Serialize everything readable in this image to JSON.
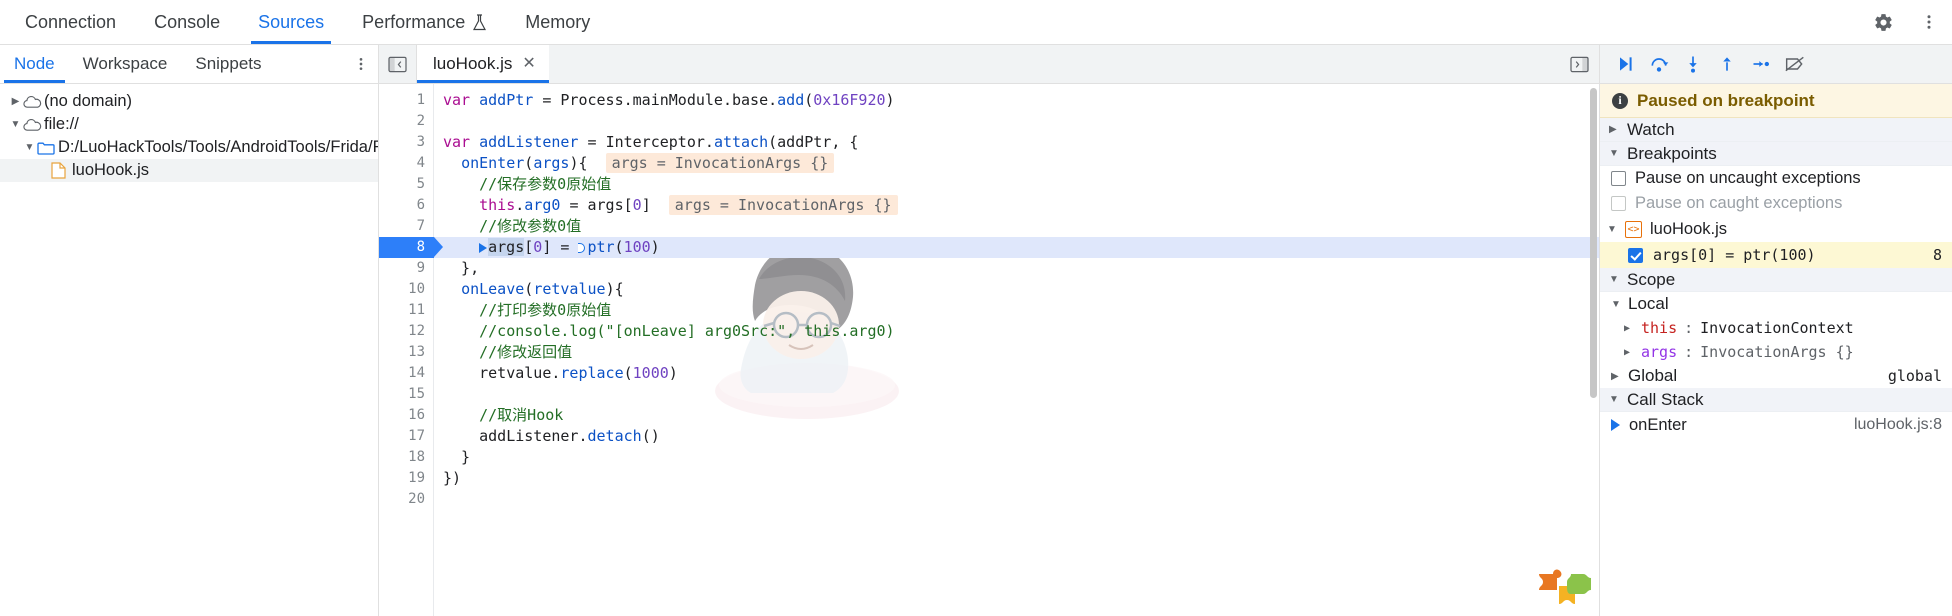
{
  "main_tabs": [
    {
      "label": "Connection",
      "selected": false,
      "icon": null
    },
    {
      "label": "Console",
      "selected": false,
      "icon": null
    },
    {
      "label": "Sources",
      "selected": true,
      "icon": null
    },
    {
      "label": "Performance",
      "selected": false,
      "icon": "flask-icon"
    },
    {
      "label": "Memory",
      "selected": false,
      "icon": null
    }
  ],
  "main_tabs_right": [
    {
      "name": "settings-gear-icon",
      "glyph": "⚙"
    },
    {
      "name": "more-vertical-icon",
      "glyph": "⋮"
    }
  ],
  "navigator": {
    "tabs": [
      {
        "label": "Node",
        "selected": true
      },
      {
        "label": "Workspace",
        "selected": false
      },
      {
        "label": "Snippets",
        "selected": false
      }
    ],
    "more_label": "⋮",
    "tree": [
      {
        "label": "(no domain)",
        "depth": 0,
        "icon": "cloud-icon",
        "expanded": false,
        "selected": false
      },
      {
        "label": "file://",
        "depth": 0,
        "icon": "cloud-icon",
        "expanded": true,
        "selected": false
      },
      {
        "label": "D:/LuoHackTools/Tools/AndroidTools/Frida/Frida-Age",
        "depth": 1,
        "icon": "folder-icon",
        "expanded": true,
        "selected": false
      },
      {
        "label": "luoHook.js",
        "depth": 2,
        "icon": "js-file-icon",
        "expanded": null,
        "selected": true
      }
    ]
  },
  "editor": {
    "panel_toggle_icon": "show-navigator-icon",
    "right_toggle_icon": "show-debugger-icon",
    "tab": {
      "label": "luoHook.js",
      "close_label": "✕"
    },
    "current_line": 8,
    "total_lines": 20,
    "lines": [
      {
        "n": 1,
        "text": "var addPtr = Process.mainModule.base.add(0x16F920)"
      },
      {
        "n": 2,
        "text": ""
      },
      {
        "n": 3,
        "text": "var addListener = Interceptor.attach(addPtr, {"
      },
      {
        "n": 4,
        "text": "  onEnter(args){",
        "inline": "args = InvocationArgs {}"
      },
      {
        "n": 5,
        "text": "    //保存参数0原始值"
      },
      {
        "n": 6,
        "text": "    this.arg0 = args[0]",
        "inline": "args = InvocationArgs {}"
      },
      {
        "n": 7,
        "text": "    //修改参数0值"
      },
      {
        "n": 8,
        "text": "    args[0] = ptr(100)"
      },
      {
        "n": 9,
        "text": "  },"
      },
      {
        "n": 10,
        "text": "  onLeave(retvalue){"
      },
      {
        "n": 11,
        "text": "    //打印参数0原始值"
      },
      {
        "n": 12,
        "text": "    //console.log(\"[onLeave] arg0Src:\", this.arg0)"
      },
      {
        "n": 13,
        "text": "    //修改返回值"
      },
      {
        "n": 14,
        "text": "    retvalue.replace(1000)"
      },
      {
        "n": 15,
        "text": ""
      },
      {
        "n": 16,
        "text": "    //取消Hook"
      },
      {
        "n": 17,
        "text": "    addListener.detach()"
      },
      {
        "n": 18,
        "text": "  }"
      },
      {
        "n": 19,
        "text": "})"
      },
      {
        "n": 20,
        "text": ""
      }
    ]
  },
  "debugger": {
    "toolbar": [
      {
        "name": "resume-button",
        "title": "Resume script execution"
      },
      {
        "name": "step-over-button",
        "title": "Step over next function call"
      },
      {
        "name": "step-into-button",
        "title": "Step into next function call"
      },
      {
        "name": "step-out-button",
        "title": "Step out of current function"
      },
      {
        "name": "step-button",
        "title": "Step"
      },
      {
        "name": "deactivate-breakpoints-button",
        "title": "Deactivate breakpoints"
      }
    ],
    "paused_message": "Paused on breakpoint",
    "watch": {
      "label": "Watch",
      "expanded": false
    },
    "breakpoints": {
      "label": "Breakpoints",
      "expanded": true,
      "pause_uncaught": {
        "label": "Pause on uncaught exceptions",
        "checked": false,
        "disabled": false
      },
      "pause_caught": {
        "label": "Pause on caught exceptions",
        "checked": false,
        "disabled": true
      },
      "file": {
        "label": "luoHook.js",
        "expanded": true
      },
      "items": [
        {
          "code": "args[0] = ptr(100)",
          "line": "8",
          "checked": true,
          "active": true
        }
      ]
    },
    "scope": {
      "label": "Scope",
      "expanded": true,
      "groups": [
        {
          "label": "Local",
          "expanded": true,
          "value": "",
          "props": [
            {
              "name": "this",
              "value": "InvocationContext",
              "purple": false
            },
            {
              "name": "args",
              "value": "InvocationArgs {}",
              "purple": true
            }
          ]
        },
        {
          "label": "Global",
          "expanded": false,
          "value": "global",
          "props": []
        }
      ]
    },
    "call_stack": {
      "label": "Call Stack",
      "expanded": true,
      "frames": [
        {
          "name": "onEnter",
          "location": "luoHook.js:8",
          "current": true
        }
      ]
    }
  }
}
